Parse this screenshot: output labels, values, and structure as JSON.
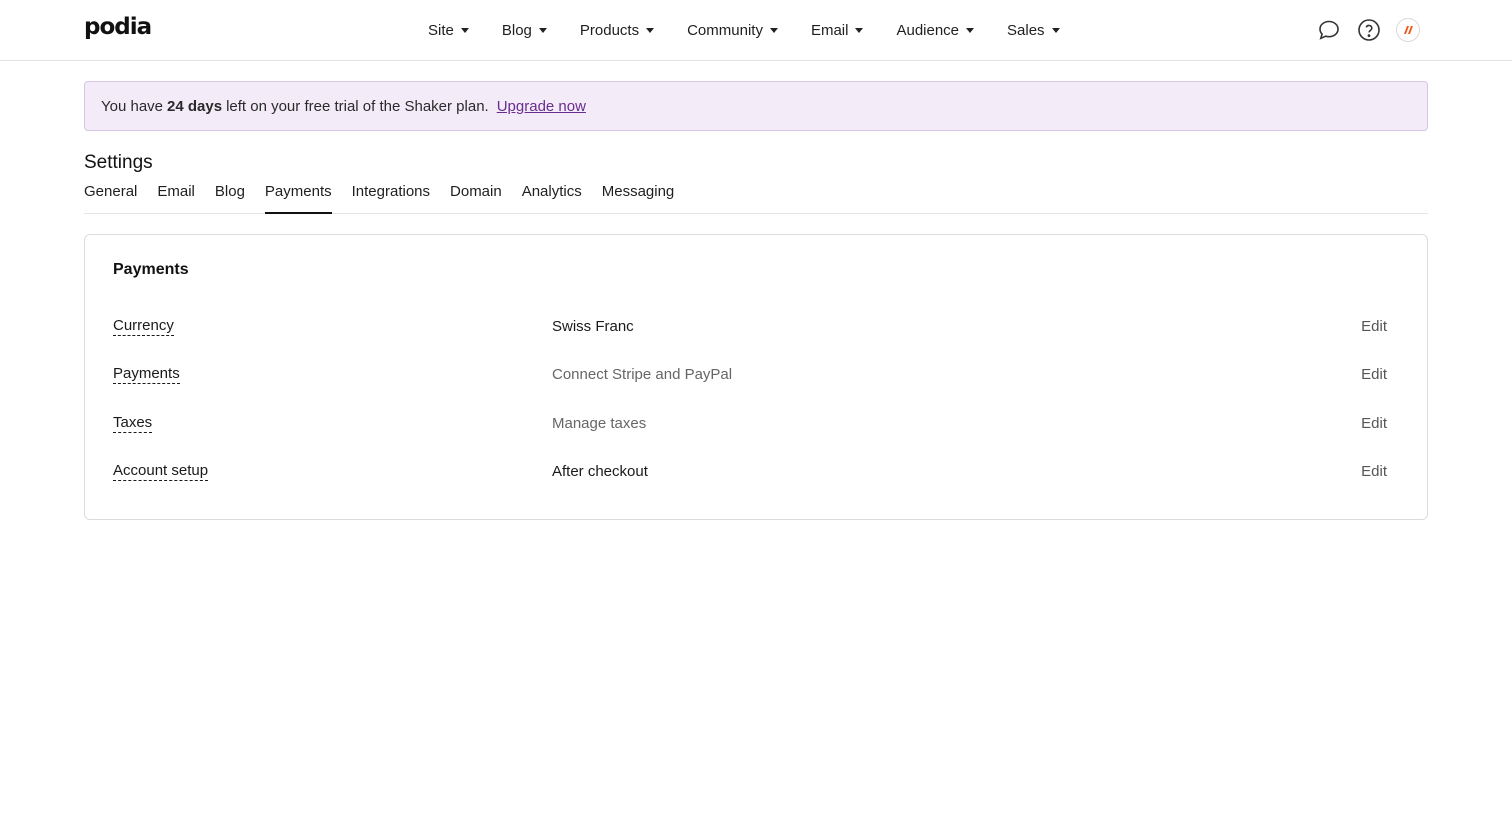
{
  "brand": {
    "logo_text": "podia"
  },
  "nav": {
    "items": [
      {
        "label": "Site"
      },
      {
        "label": "Blog"
      },
      {
        "label": "Products"
      },
      {
        "label": "Community"
      },
      {
        "label": "Email"
      },
      {
        "label": "Audience"
      },
      {
        "label": "Sales"
      }
    ],
    "icons": [
      "chat-icon",
      "help-icon",
      "avatar"
    ]
  },
  "banner": {
    "text_before": "You have",
    "days": "24 days",
    "text_after": "left on your free trial of the Shaker plan.",
    "link": "Upgrade now"
  },
  "settings": {
    "title": "Settings",
    "tabs": [
      {
        "label": "General"
      },
      {
        "label": "Email"
      },
      {
        "label": "Blog"
      },
      {
        "label": "Payments"
      },
      {
        "label": "Integrations"
      },
      {
        "label": "Domain"
      },
      {
        "label": "Analytics"
      },
      {
        "label": "Messaging"
      }
    ],
    "active_tab": "Payments"
  },
  "payments_card": {
    "title": "Payments",
    "rows": [
      {
        "label": "Currency",
        "value": "Swiss Franc",
        "action": "Edit"
      },
      {
        "label": "Payments",
        "value": "Connect Stripe and PayPal",
        "action": "Edit"
      },
      {
        "label": "Taxes",
        "value": "Manage taxes",
        "action": "Edit"
      },
      {
        "label": "Account setup",
        "value": "After checkout",
        "action": "Edit"
      }
    ]
  },
  "colors": {
    "banner_bg": "#f3ecf8",
    "banner_border": "#d8c6e6",
    "link": "#6a2c91",
    "avatar_accent": "#f05a1a"
  }
}
